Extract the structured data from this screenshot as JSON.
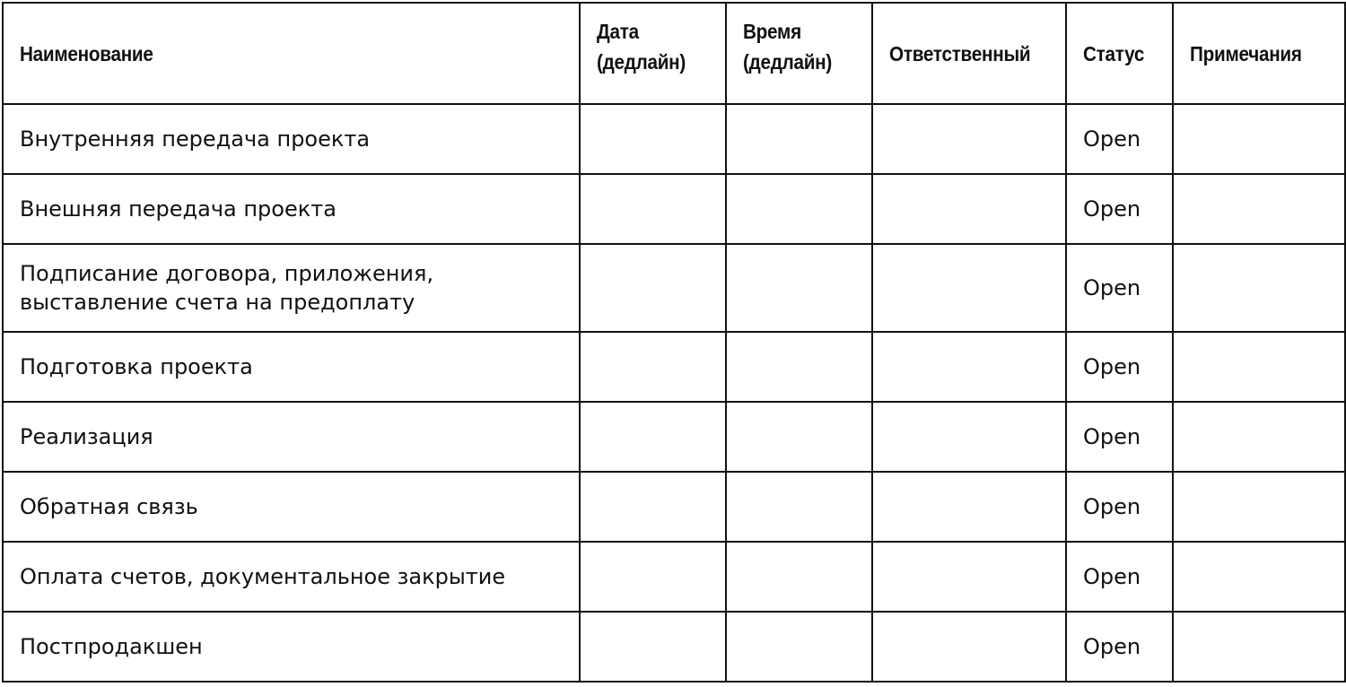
{
  "headers": [
    "Наименование",
    "Дата (дедлайн)",
    "Время (дедлайн)",
    "Ответственный",
    "Статус",
    "Примечания"
  ],
  "rows": [
    {
      "name": "Внутренняя передача проекта",
      "date": "",
      "time": "",
      "owner": "",
      "status": "Open",
      "notes": ""
    },
    {
      "name": "Внешняя передача проекта",
      "date": "",
      "time": "",
      "owner": "",
      "status": "Open",
      "notes": ""
    },
    {
      "name": "Подписание договора, приложения, выставление счета на предоплату",
      "date": "",
      "time": "",
      "owner": "",
      "status": "Open",
      "notes": ""
    },
    {
      "name": "Подготовка проекта",
      "date": "",
      "time": "",
      "owner": "",
      "status": "Open",
      "notes": ""
    },
    {
      "name": "Реализация",
      "date": "",
      "time": "",
      "owner": "",
      "status": "Open",
      "notes": ""
    },
    {
      "name": "Обратная связь",
      "date": "",
      "time": "",
      "owner": "",
      "status": "Open",
      "notes": ""
    },
    {
      "name": "Оплата счетов, документальное закрытие",
      "date": "",
      "time": "",
      "owner": "",
      "status": "Open",
      "notes": ""
    },
    {
      "name": "Постпродакшен",
      "date": "",
      "time": "",
      "owner": "",
      "status": "Open",
      "notes": ""
    }
  ]
}
